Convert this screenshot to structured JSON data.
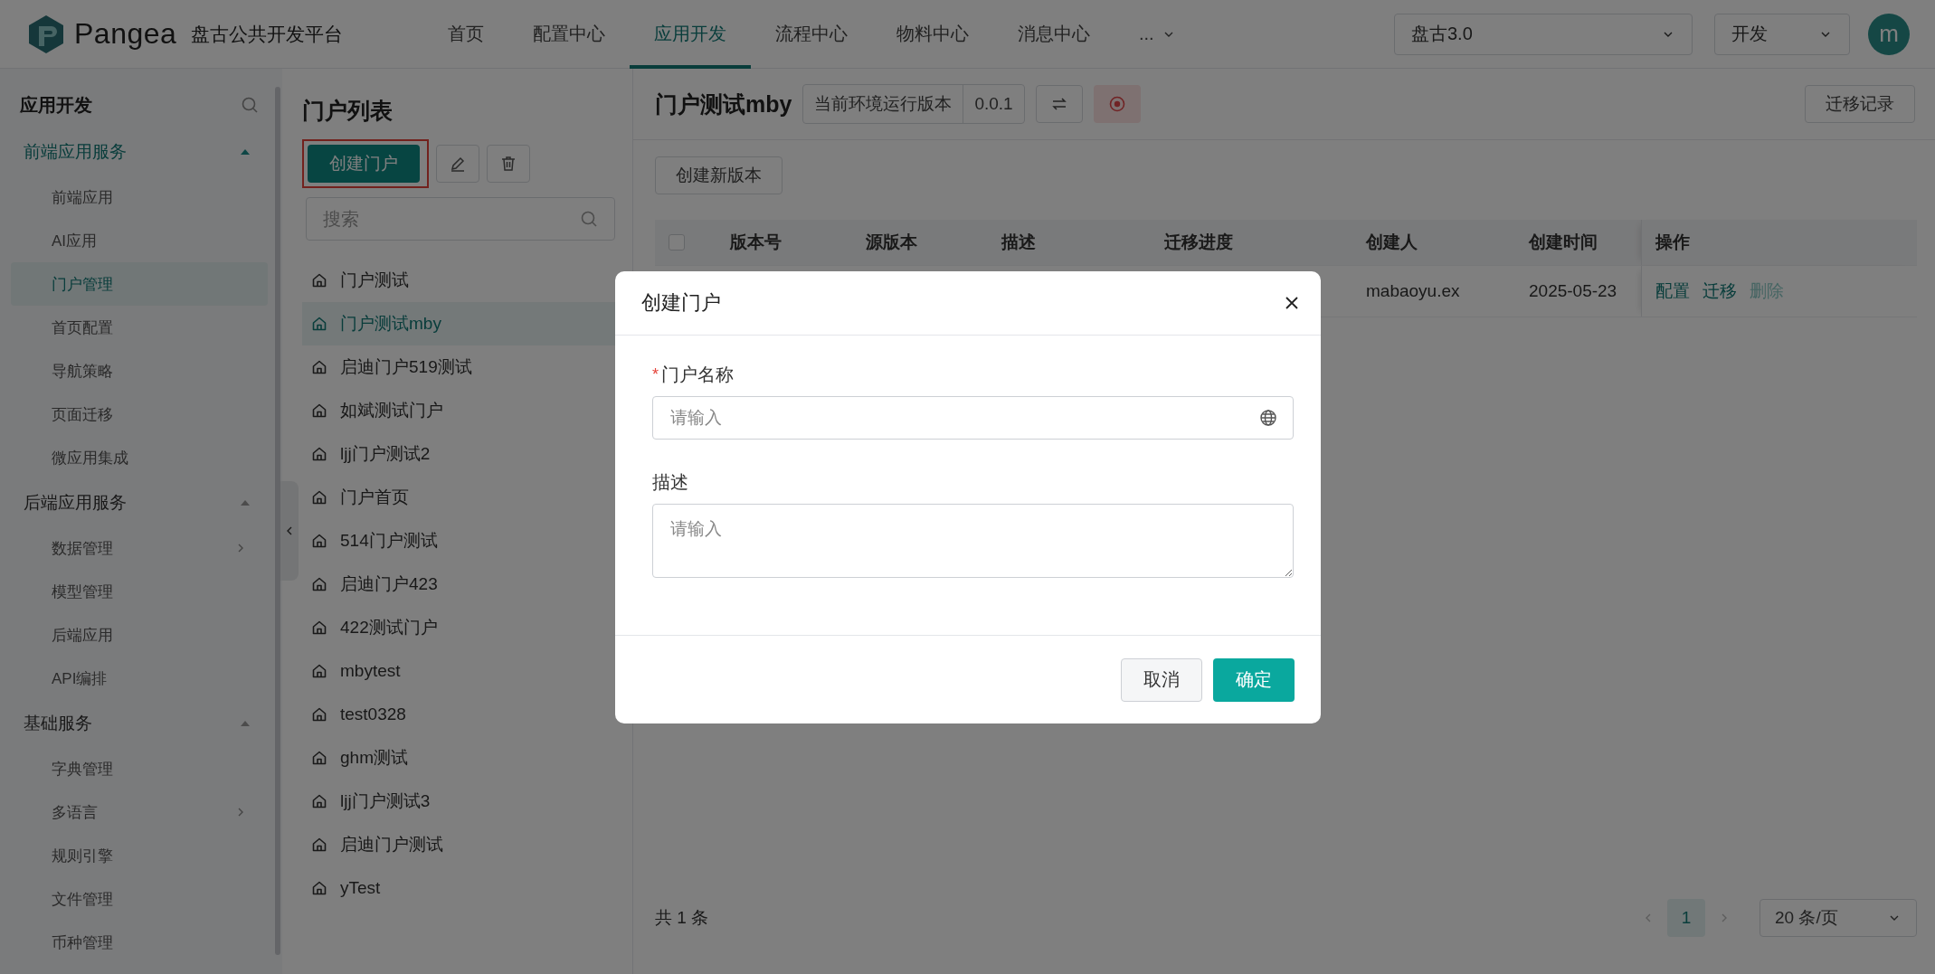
{
  "header": {
    "logo_text": "Pangea",
    "platform_name": "盘古公共开发平台",
    "nav": [
      {
        "label": "首页",
        "selected": false
      },
      {
        "label": "配置中心",
        "selected": false
      },
      {
        "label": "应用开发",
        "selected": true
      },
      {
        "label": "流程中心",
        "selected": false
      },
      {
        "label": "物料中心",
        "selected": false
      },
      {
        "label": "消息中心",
        "selected": false
      }
    ],
    "more": "...",
    "project_select": "盘古3.0",
    "env_select": "开发",
    "avatar": "m"
  },
  "sidebar": {
    "title": "应用开发",
    "groups": [
      {
        "label": "前端应用服务",
        "active": true,
        "expanded": true,
        "items": [
          {
            "label": "前端应用",
            "selected": false,
            "has_children": false
          },
          {
            "label": "AI应用",
            "selected": false,
            "has_children": false
          },
          {
            "label": "门户管理",
            "selected": true,
            "has_children": false
          },
          {
            "label": "首页配置",
            "selected": false,
            "has_children": false
          },
          {
            "label": "导航策略",
            "selected": false,
            "has_children": false
          },
          {
            "label": "页面迁移",
            "selected": false,
            "has_children": false
          },
          {
            "label": "微应用集成",
            "selected": false,
            "has_children": false
          }
        ]
      },
      {
        "label": "后端应用服务",
        "active": false,
        "expanded": true,
        "items": [
          {
            "label": "数据管理",
            "selected": false,
            "has_children": true
          },
          {
            "label": "模型管理",
            "selected": false,
            "has_children": false
          },
          {
            "label": "后端应用",
            "selected": false,
            "has_children": false
          },
          {
            "label": "API编排",
            "selected": false,
            "has_children": false
          }
        ]
      },
      {
        "label": "基础服务",
        "active": false,
        "expanded": true,
        "items": [
          {
            "label": "字典管理",
            "selected": false,
            "has_children": false
          },
          {
            "label": "多语言",
            "selected": false,
            "has_children": true
          },
          {
            "label": "规则引擎",
            "selected": false,
            "has_children": false
          },
          {
            "label": "文件管理",
            "selected": false,
            "has_children": false
          },
          {
            "label": "币种管理",
            "selected": false,
            "has_children": false
          }
        ]
      }
    ]
  },
  "portal_list": {
    "title": "门户列表",
    "create_button": {
      "label": "创建门户",
      "highlighted": true
    },
    "search_placeholder": "搜索",
    "items": [
      {
        "label": "门户测试",
        "selected": false
      },
      {
        "label": "门户测试mby",
        "selected": true
      },
      {
        "label": "启迪门户519测试",
        "selected": false
      },
      {
        "label": "如斌测试门户",
        "selected": false
      },
      {
        "label": "ljj门户测试2",
        "selected": false
      },
      {
        "label": "门户首页",
        "selected": false
      },
      {
        "label": "514门户测试",
        "selected": false
      },
      {
        "label": "启迪门户423",
        "selected": false
      },
      {
        "label": "422测试门户",
        "selected": false
      },
      {
        "label": "mbytest",
        "selected": false
      },
      {
        "label": "test0328",
        "selected": false
      },
      {
        "label": "ghm测试",
        "selected": false
      },
      {
        "label": "ljj门户测试3",
        "selected": false
      },
      {
        "label": "启迪门户测试",
        "selected": false
      },
      {
        "label": "yTest",
        "selected": false
      }
    ]
  },
  "detail": {
    "title": "门户测试mby",
    "version_label": "当前环境运行版本",
    "version": "0.0.1",
    "history_button": "迁移记录",
    "new_version_button": "创建新版本",
    "table": {
      "select_all": {
        "checked": false
      },
      "columns": [
        {
          "label": "版本号"
        },
        {
          "label": "源版本"
        },
        {
          "label": "描述"
        },
        {
          "label": "迁移进度"
        },
        {
          "label": "创建人"
        },
        {
          "label": "创建时间"
        },
        {
          "label": "操作"
        }
      ],
      "rows": [
        {
          "creator": "mabaoyu.ex",
          "created_at": "2025-05-23",
          "actions": [
            {
              "label": "配置",
              "disabled": false
            },
            {
              "label": "迁移",
              "disabled": false
            },
            {
              "label": "删除",
              "disabled": true
            }
          ]
        }
      ]
    },
    "total": "共 1 条",
    "pages": [
      {
        "label": "1",
        "selected": true
      }
    ],
    "page_size": "20 条/页"
  },
  "dialog": {
    "title": "创建门户",
    "fields": [
      {
        "kind": "input",
        "required_mark": "*",
        "label": "门户名称",
        "placeholder": "请输入"
      },
      {
        "kind": "textarea",
        "label": "描述",
        "placeholder": "请输入"
      }
    ],
    "buttons": [
      {
        "kind": "default",
        "label": "取消"
      },
      {
        "kind": "primary",
        "label": "确定"
      }
    ]
  }
}
